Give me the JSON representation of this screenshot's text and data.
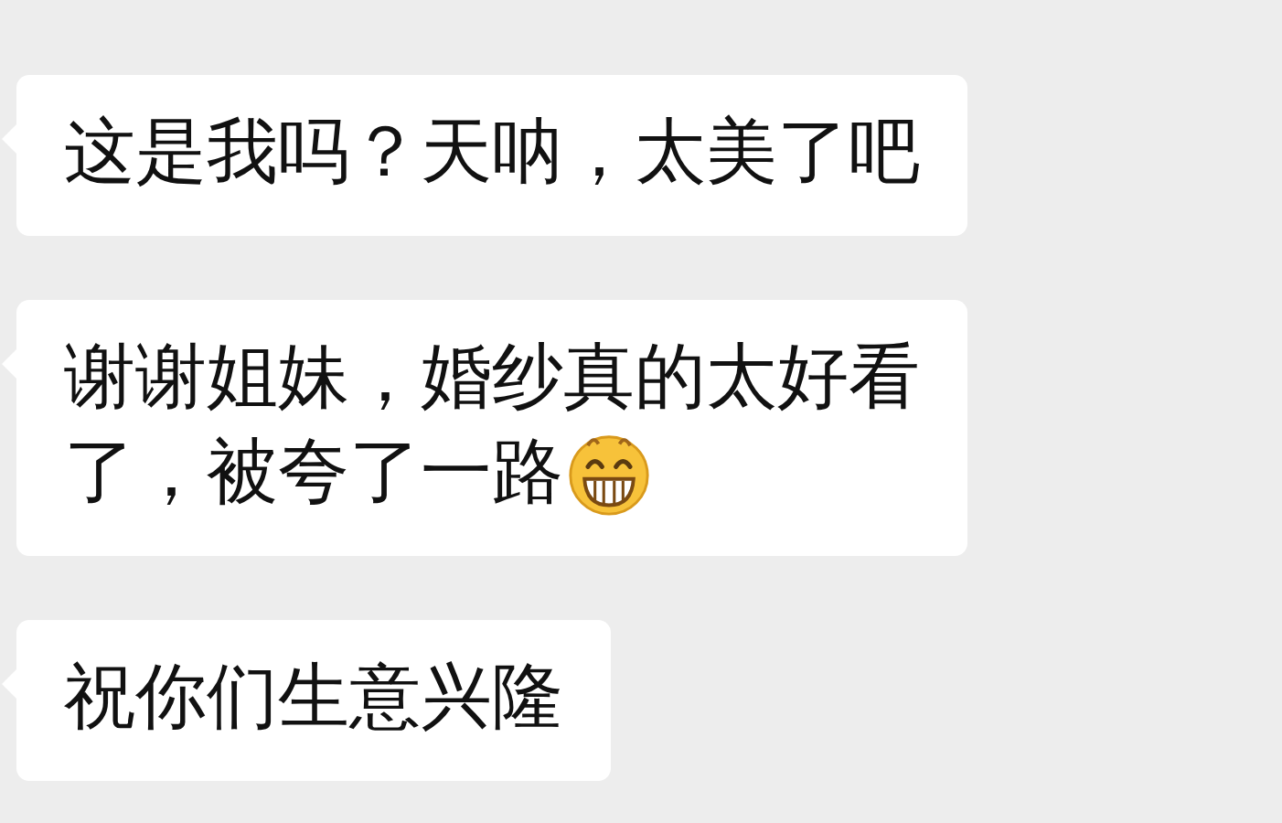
{
  "messages": [
    {
      "kind": "text",
      "lines": [
        "这是我吗？天呐，太美了吧"
      ]
    },
    {
      "kind": "text_emoji",
      "lines": [
        "谢谢姐妹，婚纱真的太好看",
        "了，被夸了一路"
      ]
    },
    {
      "kind": "text",
      "lines": [
        "祝你们生意兴隆"
      ]
    }
  ]
}
